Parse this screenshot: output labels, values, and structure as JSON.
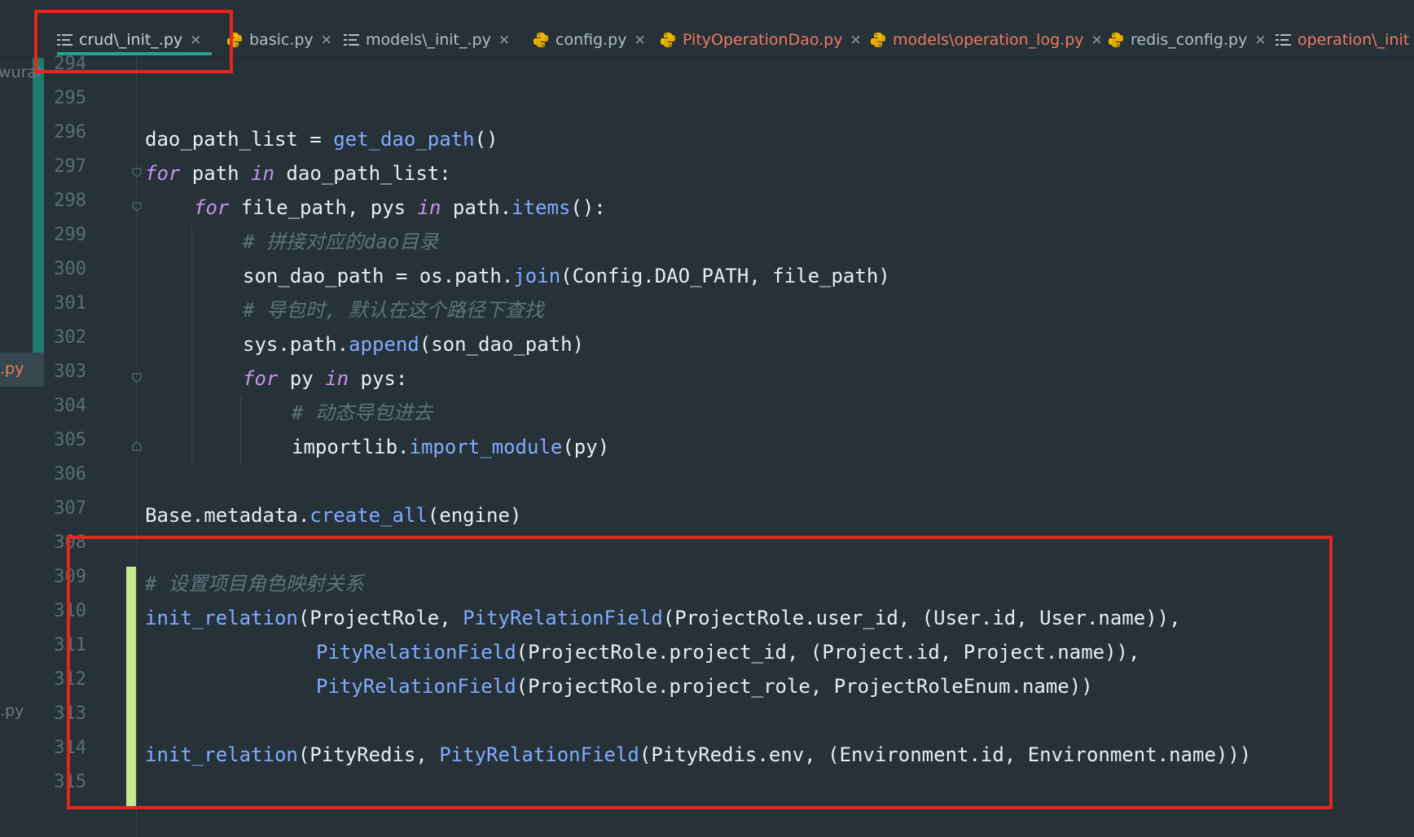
{
  "tabs": [
    {
      "label": "crud\\_init_.py",
      "icon": "list-icon",
      "state": "active"
    },
    {
      "label": "basic.py",
      "icon": "python-icon",
      "state": "normal"
    },
    {
      "label": "models\\_init_.py",
      "icon": "list-icon",
      "state": "normal"
    },
    {
      "label": "config.py",
      "icon": "python-icon",
      "state": "normal"
    },
    {
      "label": "PityOperationDao.py",
      "icon": "python-icon",
      "state": "modified"
    },
    {
      "label": "models\\operation_log.py",
      "icon": "python-icon",
      "state": "modified"
    },
    {
      "label": "redis_config.py",
      "icon": "python-icon",
      "state": "normal"
    },
    {
      "label": "operation\\_init",
      "icon": "list-icon",
      "state": "modified"
    }
  ],
  "close_glyph": "×",
  "left_panel": {
    "items": [
      "wurah",
      ".py",
      ".py"
    ]
  },
  "editor": {
    "line_numbers": [
      "294",
      "295",
      "296",
      "297",
      "298",
      "299",
      "300",
      "301",
      "302",
      "303",
      "304",
      "305",
      "306",
      "307",
      "308",
      "309",
      "310",
      "311",
      "312",
      "313",
      "314",
      "315"
    ],
    "code": {
      "l296": [
        "dao_path_list = ",
        "get_dao_path",
        "()"
      ],
      "l297": [
        "for",
        " path ",
        "in",
        " dao_path_list:"
      ],
      "l298": [
        "for",
        " file_path, pys ",
        "in",
        " path.",
        "items",
        "():"
      ],
      "l299": "# 拼接对应的dao目录",
      "l300": [
        "son_dao_path = os.path.",
        "join",
        "(Config.DAO_PATH, file_path)"
      ],
      "l301": "# 导包时, 默认在这个路径下查找",
      "l302": [
        "sys.path.",
        "append",
        "(son_dao_path)"
      ],
      "l303": [
        "for",
        " py ",
        "in",
        " pys:"
      ],
      "l304": "# 动态导包进去",
      "l305": [
        "importlib.",
        "import_module",
        "(py)"
      ],
      "l307": [
        "Base.metadata.",
        "create_all",
        "(engine)"
      ],
      "l309": "# 设置项目角色映射关系",
      "l310": [
        "init_relation",
        "(ProjectRole, ",
        "PityRelationField",
        "(ProjectRole.user_id, (User.id, User.name)),"
      ],
      "l311": [
        "PityRelationField",
        "(ProjectRole.project_id, (Project.id, Project.name)),"
      ],
      "l312": [
        "PityRelationField",
        "(ProjectRole.project_role, ProjectRoleEnum.name))"
      ],
      "l314": [
        "init_relation",
        "(PityRedis, ",
        "PityRelationField",
        "(PityRedis.env, (Environment.id, Environment.name)))"
      ]
    }
  },
  "colors": {
    "background": "#263238",
    "keyword": "#c792ea",
    "function": "#82aaff",
    "comment": "#5f727c",
    "active_tab_underline": "#22a590",
    "modified_tab": "#f07860",
    "change_bar": "#c3e88d",
    "annotation_box": "#e5261f"
  }
}
